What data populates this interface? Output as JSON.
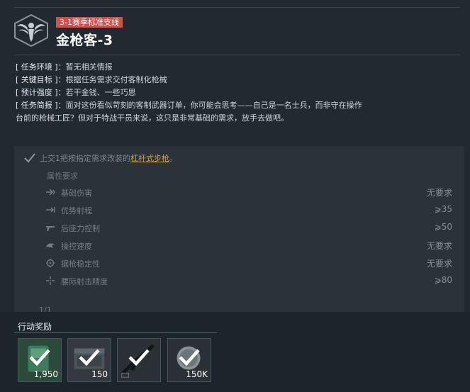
{
  "mission": {
    "badge": "3-1赛季标准支线",
    "title": "金枪客-3"
  },
  "info": [
    {
      "key": "[ 任务环境 ]",
      "value": "：暂无相关情报"
    },
    {
      "key": "[ 关键目标 ]",
      "value": "：根据任务需求交付客制化枪械"
    },
    {
      "key": "[ 预计强度 ]",
      "value": "：若干金钱、一些巧思"
    },
    {
      "key": "[ 任务简报 ]",
      "value": "：面对这份看似苛刻的客制武器订单，你可能会思考——自己是一名士兵，而非守在操作"
    }
  ],
  "info_continuation": "台前的枪械工匠？但对于特战干员来说，这只是非常基础的需求，放手去做吧。",
  "objective": {
    "text_before": "上交1把按指定需求改装的",
    "link": "杠杆式步枪",
    "text_after": "。",
    "icon": "check-icon"
  },
  "requirements": {
    "title": "属性要求",
    "items": [
      {
        "name": "基础伤害",
        "value": "无要求",
        "icon": "damage-icon"
      },
      {
        "name": "优势射程",
        "value": "⩾35",
        "icon": "range-icon"
      },
      {
        "name": "后座力控制",
        "value": "⩾50",
        "icon": "recoil-icon"
      },
      {
        "name": "操控速度",
        "value": "无要求",
        "icon": "handling-icon"
      },
      {
        "name": "据枪稳定性",
        "value": "无要求",
        "icon": "stability-icon"
      },
      {
        "name": "腰际射击精度",
        "value": "⩾80",
        "icon": "hipfire-icon"
      }
    ]
  },
  "pagination": "1/1",
  "rewards": {
    "title": "行动奖励",
    "items": [
      {
        "amount": "1,950",
        "icon": "experience-card-icon",
        "claimed": true
      },
      {
        "amount": "150",
        "icon": "ammo-crate-icon",
        "claimed": true
      },
      {
        "amount": "",
        "icon": "rifle-icon",
        "claimed": true
      },
      {
        "amount": "150K",
        "icon": "currency-coin-icon",
        "claimed": true
      }
    ]
  },
  "colors": {
    "badge": "#d3504a",
    "link": "#c8a154",
    "background": "#222a31",
    "panel": "#2a323a"
  }
}
